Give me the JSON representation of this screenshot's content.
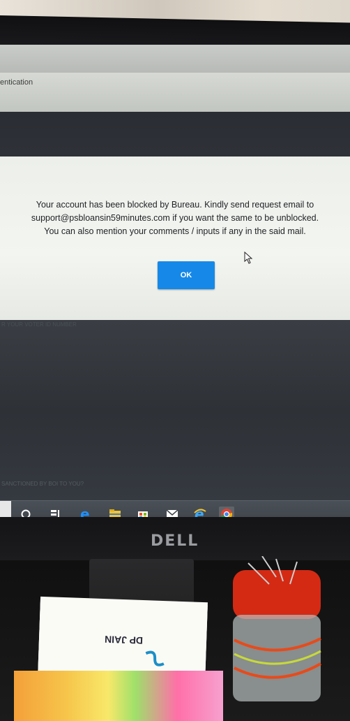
{
  "screen": {
    "header_partial_label": "entication",
    "dialog": {
      "message_line1": "Your account has been blocked by Bureau. Kindly send request email to",
      "message_line2": "support@psbloansin59minutes.com if you want the same to be unblocked.",
      "message_line3": "You can also mention your comments / inputs if any in the said mail.",
      "ok_label": "OK"
    },
    "background_text_1": "R YOUR VOTER ID NUMBER",
    "background_text_2": "SANCTIONED BY BOI TO YOU?"
  },
  "taskbar": {
    "icons": [
      "search-icon",
      "task-view-icon",
      "edge-icon",
      "file-explorer-icon",
      "store-icon",
      "mail-icon",
      "ie-icon",
      "chrome-icon"
    ]
  },
  "monitor": {
    "brand": "DELL"
  },
  "desk": {
    "card_brand": "DP JAIN"
  },
  "colors": {
    "ok_button": "#1689e8",
    "taskbar": "#3d4248",
    "dialog_bg": "#f0f2ee"
  }
}
